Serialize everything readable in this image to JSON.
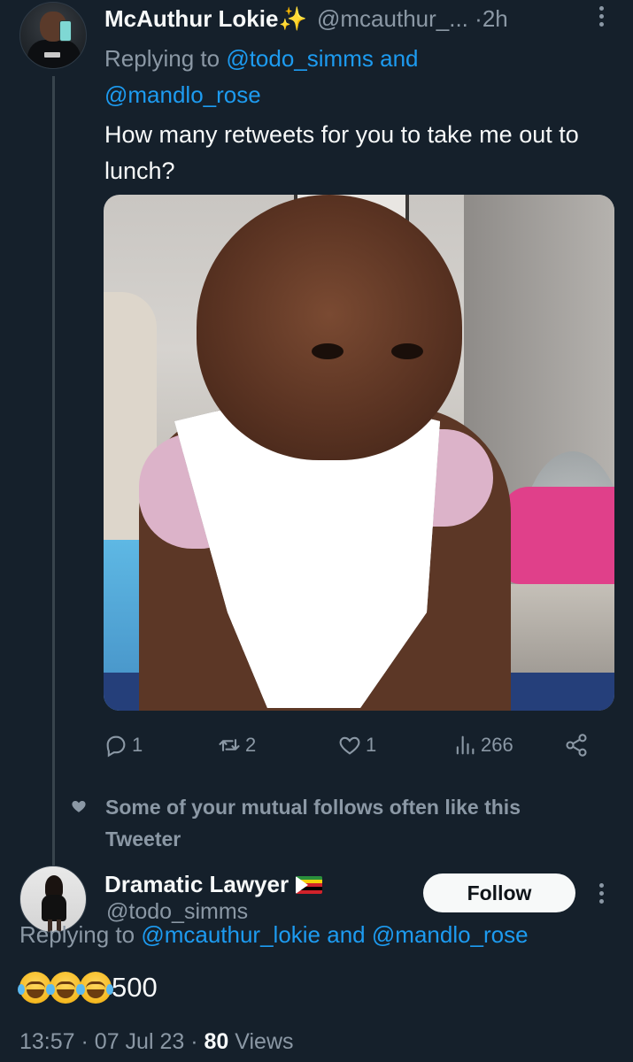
{
  "tweet": {
    "author_name": "McAuthur Lokie✨",
    "author_handle": "@mcauthur_...",
    "separator": "·",
    "age": "2h",
    "replying_prefix": "Replying to",
    "replying_to_1": "@todo_simms",
    "replying_and": "and",
    "replying_to_2": "@mandlo_rose",
    "text": "How many retweets for you to take me out to lunch?",
    "replies_count": "1",
    "retweets_count": "2",
    "likes_count": "1",
    "views_count": "266"
  },
  "social_context": {
    "text": "Some of your mutual follows often like this Tweeter"
  },
  "reply": {
    "author_name": "Dramatic Lawyer",
    "author_handle": "@todo_simms",
    "follow_label": "Follow",
    "replying_prefix": "Replying to",
    "replying_to_1": "@mcauthur_lokie",
    "replying_and": "and",
    "replying_to_2": "@mandlo_rose",
    "text_suffix": "500",
    "meta_time": "13:57",
    "meta_sep": "·",
    "meta_date": "07 Jul 23",
    "meta_views_count": "80",
    "meta_views_label": "Views"
  },
  "colors": {
    "background": "#15202b",
    "text": "#f7f9f9",
    "muted": "#8b98a5",
    "link": "#1d9bf0",
    "divider": "#38444d"
  },
  "icons": [
    "reply-icon",
    "retweet-icon",
    "like-icon",
    "views-icon",
    "share-icon",
    "more-icon",
    "heart-icon",
    "zimbabwe-flag-icon",
    "tears-of-joy-emoji"
  ]
}
